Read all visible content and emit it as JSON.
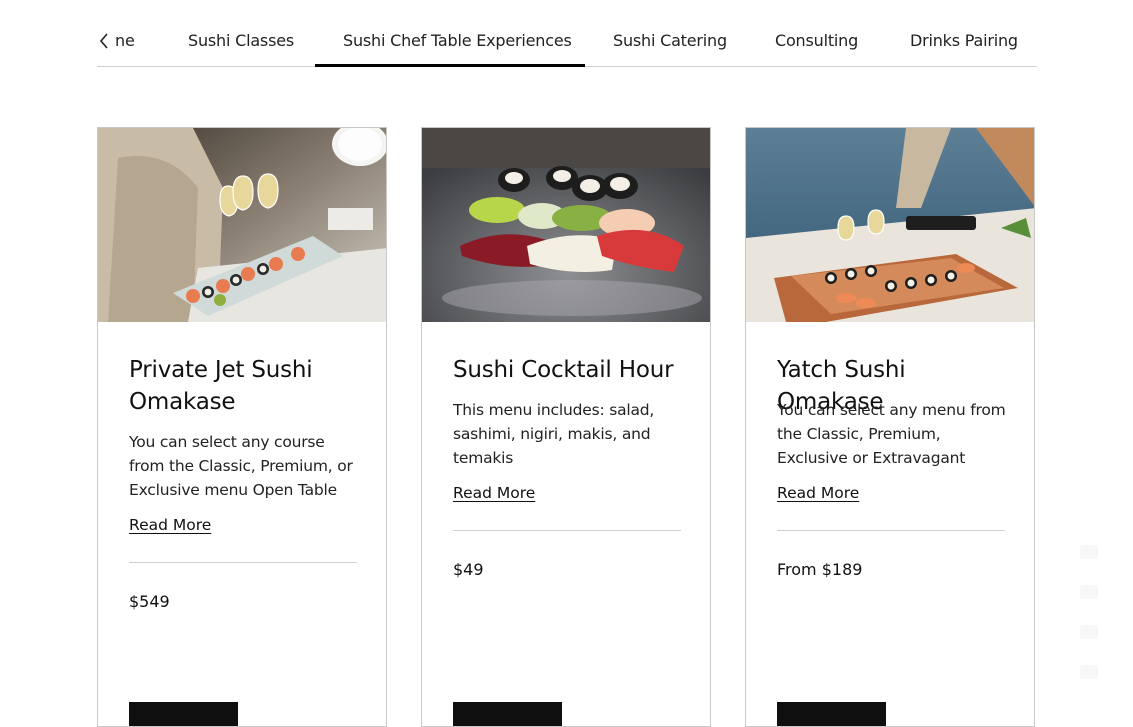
{
  "tabs": {
    "items": [
      {
        "label": "ne",
        "active": false
      },
      {
        "label": "Sushi Classes",
        "active": false
      },
      {
        "label": "Sushi Chef Table Experiences",
        "active": true
      },
      {
        "label": "Sushi Catering",
        "active": false
      },
      {
        "label": "Consulting",
        "active": false
      },
      {
        "label": "Drinks Pairing",
        "active": false
      }
    ]
  },
  "cards": [
    {
      "image": "private-jet-sushi-platter",
      "title": "Private Jet Sushi Omakase",
      "description": "You can select any course from the Classic, Premium, or Exclusive menu Open Table",
      "read_more": "Read More",
      "price": "$549"
    },
    {
      "image": "sushi-nigiri-close-up",
      "title": "Sushi Cocktail Hour",
      "description": "This menu includes: salad, sashimi, nigiri, makis, and temakis",
      "read_more": "Read More",
      "price": "$49"
    },
    {
      "image": "yacht-sushi-platter",
      "title": "Yatch Sushi Omakase",
      "description": "You can select any menu from the Classic, Premium, Exclusive or Extravagant",
      "read_more": "Read More",
      "price": "From $189"
    }
  ],
  "colors": {
    "accent": "#000000",
    "divider": "#cfcfcf",
    "card_border": "#c8c8c8"
  }
}
